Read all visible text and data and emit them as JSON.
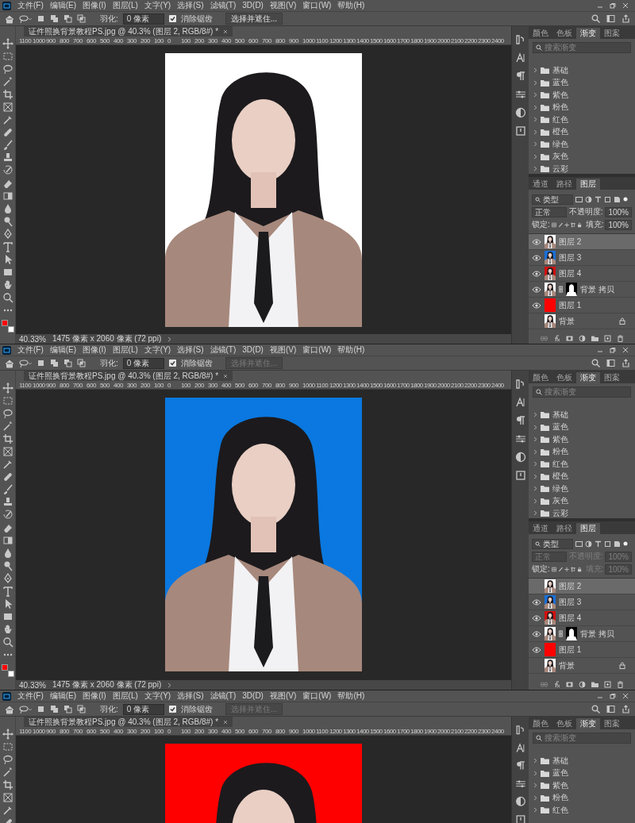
{
  "windows": [
    {
      "menu": [
        "文件(F)",
        "编辑(E)",
        "图像(I)",
        "图层(L)",
        "文字(Y)",
        "选择(S)",
        "滤镜(T)",
        "3D(D)",
        "视图(V)",
        "窗口(W)",
        "帮助(H)"
      ],
      "options": {
        "feather_label": "羽化:",
        "feather_value": "0 像素",
        "antialias": {
          "label": "消除锯齿",
          "checked": true
        },
        "select_mask": {
          "label": "选择并遮住...",
          "disabled": false
        }
      },
      "document_tab": "证件照换背景教程PS.jpg @ 40.3% (图层 2, RGB/8#) *",
      "ruler": [
        "1100",
        "1000",
        "900",
        "800",
        "700",
        "600",
        "500",
        "400",
        "300",
        "200",
        "100",
        "0",
        "100",
        "200",
        "300",
        "400",
        "500",
        "600",
        "700",
        "800",
        "900",
        "1000",
        "1100",
        "1200",
        "1300",
        "1400",
        "1500",
        "1600",
        "1700",
        "1800",
        "1900",
        "2000",
        "2100",
        "2200",
        "2300",
        "2400"
      ],
      "color_swatches": [
        {
          "kind": "foreground",
          "color": "#ff0000"
        },
        {
          "kind": "background",
          "color": "#ffffff"
        }
      ],
      "photo": {
        "color": "#ffffff"
      },
      "status_bar": {
        "zoom": "40.33%",
        "info": "1475 像素 x 2060 像素 (72 ppi)"
      },
      "gradients_panel": {
        "tabs": [
          {
            "label": "颜色",
            "selected": false
          },
          {
            "label": "色板",
            "selected": false
          },
          {
            "label": "渐变",
            "selected": true
          },
          {
            "label": "图案",
            "selected": false
          }
        ],
        "search_placeholder": "搜索渐变",
        "folders": [
          "基础",
          "蓝色",
          "紫色",
          "粉色",
          "红色",
          "橙色",
          "绿色",
          "灰色",
          "云彩"
        ]
      },
      "layers_panel": {
        "tabs": [
          {
            "label": "通道",
            "selected": false
          },
          {
            "label": "路径",
            "selected": false
          },
          {
            "label": "图层",
            "selected": true
          }
        ],
        "filter": "类型",
        "blend_mode": "正常",
        "opacity_label": "不透明度:",
        "opacity_value": "100%",
        "controls_disabled": false,
        "lock_label": "锁定:",
        "fill_label": "填充:",
        "fill_value": "100%",
        "layers": [
          {
            "name": "图层 2",
            "kind": "photo",
            "color": "#ffffff",
            "visible": true,
            "selected": true,
            "locked": false
          },
          {
            "name": "图层 3",
            "kind": "photo",
            "color": "#1a6fd8",
            "visible": true,
            "selected": false,
            "locked": false
          },
          {
            "name": "图层 4",
            "kind": "photo",
            "color": "#d01010",
            "visible": true,
            "selected": false,
            "locked": false
          },
          {
            "name": "背景 拷贝",
            "kind": "photo_mask",
            "color": "#ffffff",
            "visible": true,
            "selected": false,
            "locked": false
          },
          {
            "name": "图层 1",
            "kind": "fill",
            "color": "#ff0000",
            "visible": true,
            "selected": false,
            "locked": false
          },
          {
            "name": "背景",
            "kind": "photo",
            "color": "#ffffff",
            "visible": false,
            "selected": false,
            "locked": true
          }
        ]
      }
    },
    {
      "menu": [
        "文件(F)",
        "编辑(E)",
        "图像(I)",
        "图层(L)",
        "文字(Y)",
        "选择(S)",
        "滤镜(T)",
        "3D(D)",
        "视图(V)",
        "窗口(W)",
        "帮助(H)"
      ],
      "options": {
        "feather_label": "羽化:",
        "feather_value": "0 像素",
        "antialias": {
          "label": "消除锯齿",
          "checked": true
        },
        "select_mask": {
          "label": "选择并遮住...",
          "disabled": true
        }
      },
      "document_tab": "证件照换背景教程PS.jpg @ 40.3% (图层 2, RGB/8#) *",
      "ruler": [
        "1100",
        "1000",
        "900",
        "800",
        "700",
        "600",
        "500",
        "400",
        "300",
        "200",
        "100",
        "0",
        "100",
        "200",
        "300",
        "400",
        "500",
        "600",
        "700",
        "800",
        "900",
        "1000",
        "1100",
        "1200",
        "1300",
        "1400",
        "1500",
        "1600",
        "1700",
        "1800",
        "1900",
        "2000",
        "2100",
        "2200",
        "2300",
        "2400"
      ],
      "color_swatches": [
        {
          "kind": "foreground",
          "color": "#ff0000"
        },
        {
          "kind": "background",
          "color": "#ffffff"
        }
      ],
      "photo": {
        "color": "#0a78e0"
      },
      "status_bar": {
        "zoom": "40.33%",
        "info": "1475 像素 x 2060 像素 (72 ppi)"
      },
      "gradients_panel": {
        "tabs": [
          {
            "label": "颜色",
            "selected": false
          },
          {
            "label": "色板",
            "selected": false
          },
          {
            "label": "渐变",
            "selected": true
          },
          {
            "label": "图案",
            "selected": false
          }
        ],
        "search_placeholder": "搜索渐变",
        "folders": [
          "基础",
          "蓝色",
          "紫色",
          "粉色",
          "红色",
          "橙色",
          "绿色",
          "灰色",
          "云彩"
        ]
      },
      "layers_panel": {
        "tabs": [
          {
            "label": "通道",
            "selected": false
          },
          {
            "label": "路径",
            "selected": false
          },
          {
            "label": "图层",
            "selected": true
          }
        ],
        "filter": "类型",
        "blend_mode": "正常",
        "opacity_label": "不透明度:",
        "opacity_value": "100%",
        "controls_disabled": true,
        "lock_label": "锁定:",
        "fill_label": "填充:",
        "fill_value": "100%",
        "layers": [
          {
            "name": "图层 2",
            "kind": "photo",
            "color": "#ffffff",
            "visible": false,
            "selected": true,
            "locked": false
          },
          {
            "name": "图层 3",
            "kind": "photo",
            "color": "#1a6fd8",
            "visible": true,
            "selected": false,
            "locked": false
          },
          {
            "name": "图层 4",
            "kind": "photo",
            "color": "#d01010",
            "visible": true,
            "selected": false,
            "locked": false
          },
          {
            "name": "背景 拷贝",
            "kind": "photo_mask",
            "color": "#ffffff",
            "visible": true,
            "selected": false,
            "locked": false
          },
          {
            "name": "图层 1",
            "kind": "fill",
            "color": "#ff0000",
            "visible": true,
            "selected": false,
            "locked": false
          },
          {
            "name": "背景",
            "kind": "photo",
            "color": "#ffffff",
            "visible": false,
            "selected": false,
            "locked": true
          }
        ]
      }
    },
    {
      "menu": [
        "文件(F)",
        "编辑(E)",
        "图像(I)",
        "图层(L)",
        "文字(Y)",
        "选择(S)",
        "滤镜(T)",
        "3D(D)",
        "视图(V)",
        "窗口(W)",
        "帮助(H)"
      ],
      "options": {
        "feather_label": "羽化:",
        "feather_value": "0 像素",
        "antialias": {
          "label": "消除锯齿",
          "checked": true
        },
        "select_mask": {
          "label": "选择并遮住...",
          "disabled": true
        }
      },
      "document_tab": "证件照换背景教程PS.jpg @ 40.3% (图层 2, RGB/8#) *",
      "ruler": [
        "1100",
        "1000",
        "900",
        "800",
        "700",
        "600",
        "500",
        "400",
        "300",
        "200",
        "100",
        "0",
        "100",
        "200",
        "300",
        "400",
        "500",
        "600",
        "700",
        "800",
        "900",
        "1000",
        "1100",
        "1200",
        "1300",
        "1400",
        "1500",
        "1600",
        "1700",
        "1800",
        "1900",
        "2000",
        "2100",
        "2200",
        "2300",
        "2400"
      ],
      "photo": {
        "color": "#ff0000"
      },
      "gradients_panel": {
        "tabs": [
          {
            "label": "颜色",
            "selected": false
          },
          {
            "label": "色板",
            "selected": false
          },
          {
            "label": "渐变",
            "selected": true
          },
          {
            "label": "图案",
            "selected": false
          }
        ],
        "search_placeholder": "搜索渐变",
        "folders": [
          "基础",
          "蓝色",
          "紫色",
          "粉色",
          "红色"
        ]
      }
    }
  ]
}
